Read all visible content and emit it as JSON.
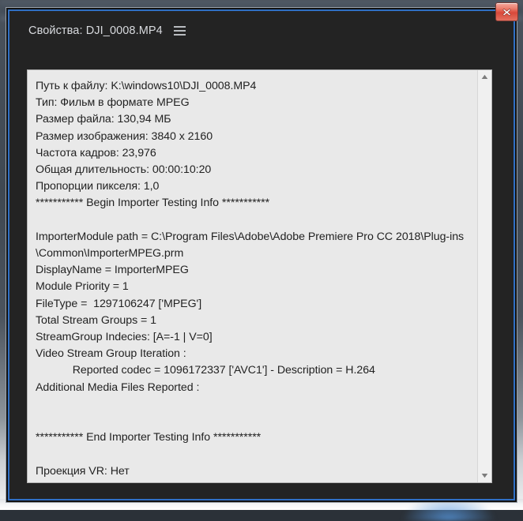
{
  "window": {
    "title_label": "Свойства: DJI_0008.MP4",
    "menu_icon": "hamburger-menu-icon",
    "close_icon": "close-icon",
    "accent_border_color": "#2f6fc4",
    "close_button_color": "#d9483a",
    "panel_background": "#e9e9e9",
    "titlebar_background": "#232323"
  },
  "properties": {
    "lines": [
      "Путь к файлу: K:\\windows10\\DJI_0008.MP4",
      "Тип: Фильм в формате MPEG",
      "Размер файла: 130,94 МБ",
      "Размер изображения: 3840 x 2160",
      "Частота кадров: 23,976",
      "Общая длительность: 00:00:10:20",
      "Пропорции пикселя: 1,0",
      "*********** Begin Importer Testing Info ***********",
      "",
      "ImporterModule path = C:\\Program Files\\Adobe\\Adobe Premiere Pro CC 2018\\Plug-ins",
      "\\Common\\ImporterMPEG.prm",
      "DisplayName = ImporterMPEG",
      "Module Priority = 1",
      "FileType =  1297106247 ['MPEG']",
      "Total Stream Groups = 1",
      "StreamGroup Indecies: [A=-1 | V=0]",
      "Video Stream Group Iteration :",
      "            Reported codec = 1096172337 ['AVC1'] - Description = H.264",
      "Additional Media Files Reported :",
      "",
      "",
      "*********** End Importer Testing Info ***********",
      "",
      "Проекция VR: Нет"
    ],
    "text": "Путь к файлу: K:\\windows10\\DJI_0008.MP4\nТип: Фильм в формате MPEG\nРазмер файла: 130,94 МБ\nРазмер изображения: 3840 x 2160\nЧастота кадров: 23,976\nОбщая длительность: 00:00:10:20\nПропорции пикселя: 1,0\n*********** Begin Importer Testing Info ***********\n\nImporterModule path = C:\\Program Files\\Adobe\\Adobe Premiere Pro CC 2018\\Plug-ins\n\\Common\\ImporterMPEG.prm\nDisplayName = ImporterMPEG\nModule Priority = 1\nFileType =  1297106247 ['MPEG']\nTotal Stream Groups = 1\nStreamGroup Indecies: [A=-1 | V=0]\nVideo Stream Group Iteration :\n            Reported codec = 1096172337 ['AVC1'] - Description = H.264\nAdditional Media Files Reported :\n\n\n*********** End Importer Testing Info ***********\n\nПроекция VR: Нет"
  },
  "scrollbar": {
    "up_icon": "scroll-up-arrow-icon",
    "down_icon": "scroll-down-arrow-icon"
  }
}
